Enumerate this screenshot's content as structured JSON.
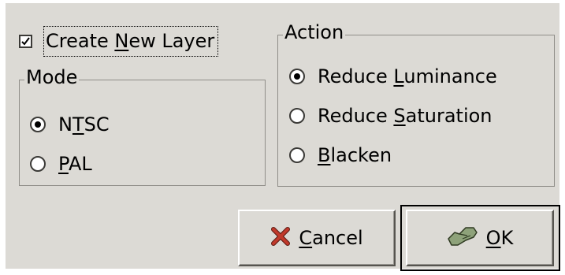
{
  "create_layer": {
    "label_before": "Create ",
    "label_mnemonic": "N",
    "label_after": "ew Layer",
    "checked": true
  },
  "mode": {
    "title": "Mode",
    "options": [
      {
        "before": "N",
        "mnemonic": "T",
        "after": "SC",
        "selected": true
      },
      {
        "before": "",
        "mnemonic": "P",
        "after": "AL",
        "selected": false
      }
    ]
  },
  "action": {
    "title": "Action",
    "options": [
      {
        "before": "Reduce ",
        "mnemonic": "L",
        "after": "uminance",
        "selected": true
      },
      {
        "before": "Reduce ",
        "mnemonic": "S",
        "after": "aturation",
        "selected": false
      },
      {
        "before": "",
        "mnemonic": "B",
        "after": "lacken",
        "selected": false
      }
    ]
  },
  "buttons": {
    "cancel": {
      "mnemonic": "C",
      "after": "ancel",
      "icon": "cancel-x-icon"
    },
    "ok": {
      "mnemonic": "O",
      "after": "K",
      "icon": "ok-hand-icon",
      "default": true
    }
  },
  "colors": {
    "dialog_bg": "#dcdad5",
    "frame_border": "#8f8d88",
    "cancel_icon": "#c0392b",
    "ok_icon": "#8ea27a"
  }
}
